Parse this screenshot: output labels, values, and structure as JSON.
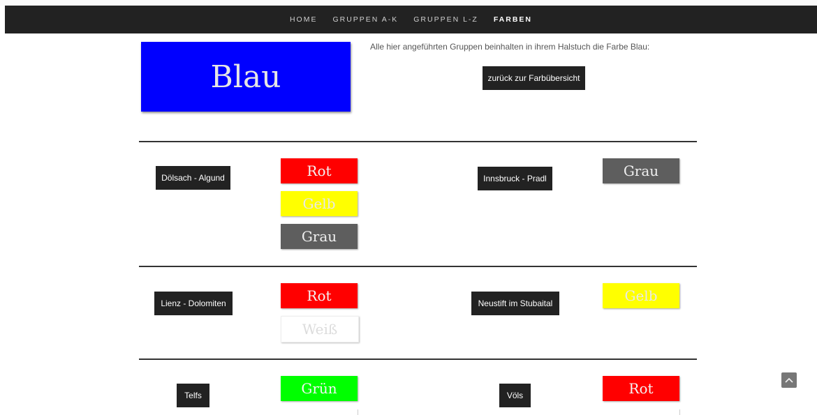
{
  "nav": {
    "items": [
      {
        "label": "HOME",
        "active": false
      },
      {
        "label": "GRUPPEN A-K",
        "active": false
      },
      {
        "label": "GRUPPEN L-Z",
        "active": false
      },
      {
        "label": "FARBEN",
        "active": true
      }
    ]
  },
  "hero": {
    "color_name": "Blau",
    "color": "#0000ff",
    "intro_text": "Alle hier angeführten Gruppen beinhalten in ihrem Halstuch die Farbe Blau:",
    "back_button": "zurück zur Farbübersicht"
  },
  "groups": [
    {
      "name": "Dölsach - Algund",
      "colors": [
        "Rot",
        "Gelb",
        "Grau"
      ]
    },
    {
      "name": "Innsbruck - Pradl",
      "colors": [
        "Grau"
      ]
    },
    {
      "name": "Lienz - Dolomiten",
      "colors": [
        "Rot",
        "Weiß"
      ]
    },
    {
      "name": "Neustift im Stubaital",
      "colors": [
        "Gelb"
      ]
    },
    {
      "name": "Telfs",
      "colors": [
        "Grün"
      ]
    },
    {
      "name": "Völs",
      "colors": [
        "Rot"
      ]
    }
  ],
  "colors": {
    "navbar": "#222222",
    "rot": "#ff0000",
    "gelb": "#ffff00",
    "grau": "#5e5e5e",
    "weiss": "#ffffff",
    "gruen": "#00ff00"
  },
  "scroll_top_icon": "chevron-up-icon"
}
